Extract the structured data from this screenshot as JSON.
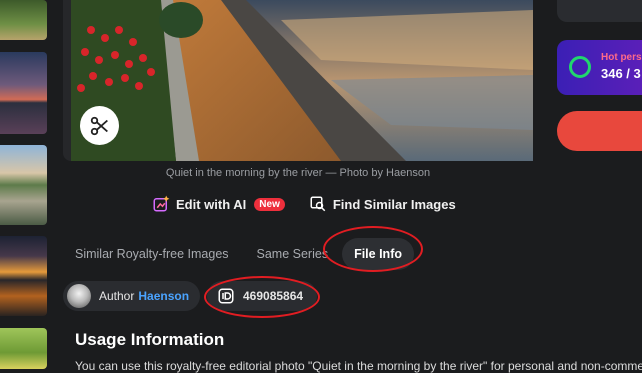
{
  "photo": {
    "caption": "Quiet in the morning by the river — Photo by Haenson",
    "icon": "scissors-icon"
  },
  "actions": {
    "edit_ai_label": "Edit with AI",
    "edit_ai_badge": "New",
    "find_similar_label": "Find Similar Images"
  },
  "tabs": [
    {
      "label": "Similar Royalty-free Images",
      "active": false
    },
    {
      "label": "Same Series",
      "active": false
    },
    {
      "label": "File Info",
      "active": true
    }
  ],
  "info": {
    "author_prefix": "Author",
    "author_name": "Haenson",
    "file_id": "469085864"
  },
  "usage": {
    "title": "Usage Information",
    "text": "You can use this royalty-free editorial photo \"Quiet in the morning by the river\" for personal and non-comme"
  },
  "sidebar": {
    "hot_label": "Hot pers",
    "hot_count": "346 / 3"
  },
  "colors": {
    "accent_red": "#e11d22",
    "link_blue": "#4aa3ff",
    "badge_red": "#ee2f3c",
    "hot_ring": "#21d66e"
  }
}
